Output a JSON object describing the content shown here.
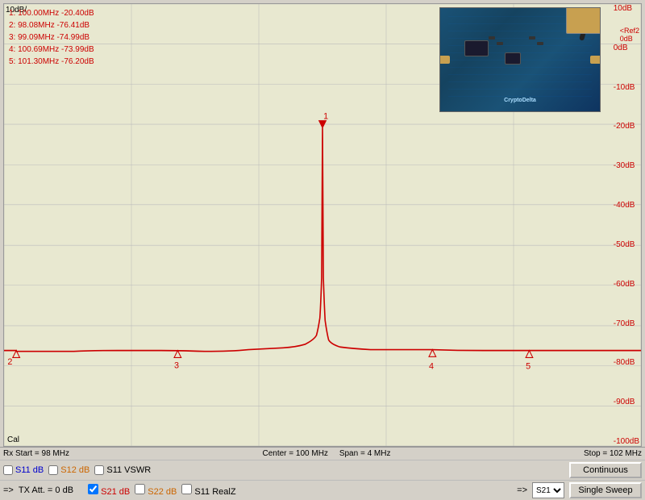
{
  "chart": {
    "left_axis_label": "10dB/",
    "cal_label": "Cal",
    "bottom_info": {
      "left": "Rx Start = 98 MHz",
      "center_top": "Center = 100 MHz",
      "center_bottom": "Span = 4 MHz",
      "right": "Stop = 102 MHz"
    },
    "right_axis_labels": [
      "10dB",
      "0dB",
      "-10dB",
      "-20dB",
      "-30dB",
      "-40dB",
      "-50dB",
      "-60dB",
      "-70dB",
      "-80dB",
      "-90dB",
      "-100dB"
    ],
    "ref_label": "<Ref2\n0dB",
    "markers": [
      {
        "num": "1:",
        "freq": "100.00MHz",
        "value": "-20.40dB"
      },
      {
        "num": "2:",
        "freq": "98.08MHz",
        "value": "-76.41dB"
      },
      {
        "num": "3:",
        "freq": "99.09MHz",
        "value": "-74.99dB"
      },
      {
        "num": "4:",
        "freq": "100.69MHz",
        "value": "-73.99dB"
      },
      {
        "num": "5:",
        "freq": "101.30MHz",
        "value": "-76.20dB"
      }
    ]
  },
  "controls": {
    "row1": {
      "s11_db_label": "S11 dB",
      "s12_db_label": "S12 dB",
      "s11_vswr_label": "S11 VSWR",
      "s21_db_label": "S21 dB",
      "s22_db_label": "S22 dB",
      "s11_realz_label": "S11 RealZ",
      "continuous_label": "Continuous",
      "single_sweep_label": "Single Sweep"
    },
    "row2": {
      "arrow_left": "=>",
      "tx_att_label": "TX Att. = 0 dB",
      "arrow_right": "=>",
      "s21_select": "S21",
      "source_select": "S21"
    }
  }
}
